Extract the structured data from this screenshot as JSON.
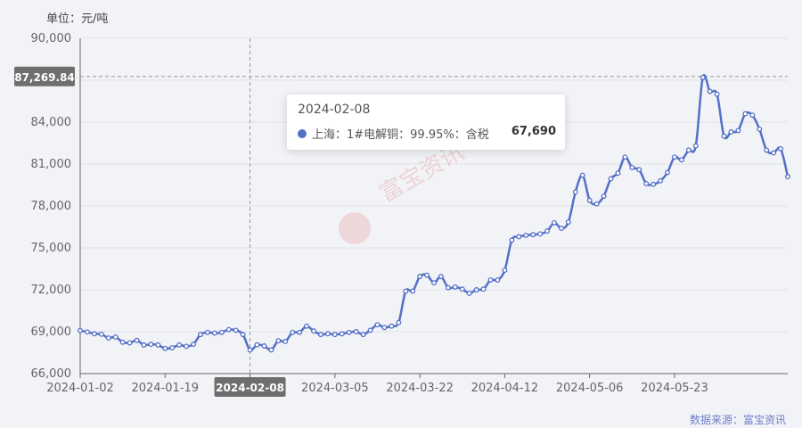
{
  "unit_label": "单位：元/吨",
  "source_label": "数据来源：富宝资讯",
  "watermark": "富宝资讯",
  "colors": {
    "line": "#5470c6",
    "axis": "#666666",
    "grid": "#dfe1e7",
    "badge": "#6e6e6e"
  },
  "tooltip": {
    "date": "2024-02-08",
    "series_name": "上海：1#电解铜：99.95%：含税",
    "value": "67,690"
  },
  "crosshair": {
    "x_label": "2024-02-08",
    "y_value": 87269.84,
    "y_label": "87,269.84"
  },
  "chart_data": {
    "type": "line",
    "ylim": [
      66000,
      90000
    ],
    "y_ticks": [
      66000,
      69000,
      72000,
      75000,
      78000,
      81000,
      84000,
      87000,
      90000
    ],
    "y_tick_labels": [
      "66,000",
      "69,000",
      "72,000",
      "75,000",
      "78,000",
      "81,000",
      "84,000",
      "87,000",
      "90,000"
    ],
    "x_tick_labels": [
      "2024-01-02",
      "2024-01-19",
      "2024-02-08",
      "2024-03-05",
      "2024-03-22",
      "2024-04-12",
      "2024-05-06",
      "2024-05-23"
    ],
    "x_tick_indices": [
      0,
      12,
      24,
      36,
      48,
      60,
      72,
      84
    ],
    "hover_index": 24,
    "series": [
      {
        "values": [
          69080,
          68980,
          68850,
          68820,
          68550,
          68620,
          68250,
          68200,
          68380,
          68050,
          68100,
          68050,
          67800,
          67850,
          68050,
          67950,
          68100,
          68800,
          68950,
          68900,
          68950,
          69150,
          69100,
          68800,
          67690,
          68060,
          67980,
          67700,
          68350,
          68300,
          68950,
          68950,
          69400,
          69050,
          68800,
          68850,
          68800,
          68850,
          68950,
          69000,
          68800,
          69100,
          69500,
          69300,
          69400,
          69650,
          71900,
          71900,
          72950,
          73050,
          72500,
          72950,
          72150,
          72200,
          72050,
          71750,
          72000,
          72050,
          72700,
          72700,
          73400,
          75550,
          75800,
          75900,
          75950,
          76000,
          76200,
          76800,
          76400,
          76850,
          79000,
          80200,
          78400,
          78150,
          78700,
          79950,
          80350,
          81500,
          80750,
          80600,
          79600,
          79550,
          79800,
          80400,
          81500,
          81300,
          82000,
          82300,
          87200,
          86200,
          86000,
          83000,
          83300,
          83400,
          84600,
          84500,
          83500,
          82000,
          81800,
          82100,
          80100
        ]
      }
    ]
  }
}
